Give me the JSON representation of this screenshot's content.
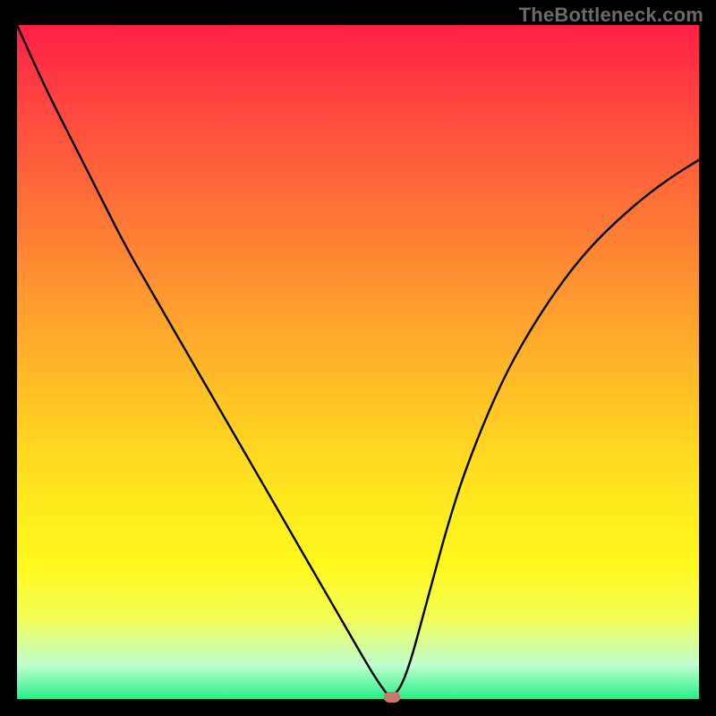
{
  "watermark": "TheBottleneck.com",
  "chart_data": {
    "type": "line",
    "title": "",
    "xlabel": "",
    "ylabel": "",
    "x_range": [
      0,
      100
    ],
    "y_range": [
      0,
      100
    ],
    "series": [
      {
        "name": "curve",
        "x": [
          0,
          4,
          8,
          12,
          16,
          20,
          24,
          28,
          32,
          36,
          40,
          44,
          48,
          52,
          54,
          55,
          57,
          60,
          64,
          68,
          72,
          76,
          80,
          84,
          88,
          92,
          96,
          100
        ],
        "y": [
          100,
          91,
          83,
          75,
          67,
          60,
          53,
          46,
          39,
          32,
          25,
          18,
          11,
          4,
          1,
          0,
          3,
          14,
          29,
          40,
          49,
          56,
          62,
          67,
          71,
          74.5,
          77.5,
          80
        ]
      }
    ],
    "marker": {
      "x": 55,
      "y": 0,
      "color": "#c7796b"
    },
    "gradient_colors": {
      "top": "#ff1f47",
      "mid": "#ffe81e",
      "bottom": "#27ef87"
    },
    "background": "#000000"
  }
}
